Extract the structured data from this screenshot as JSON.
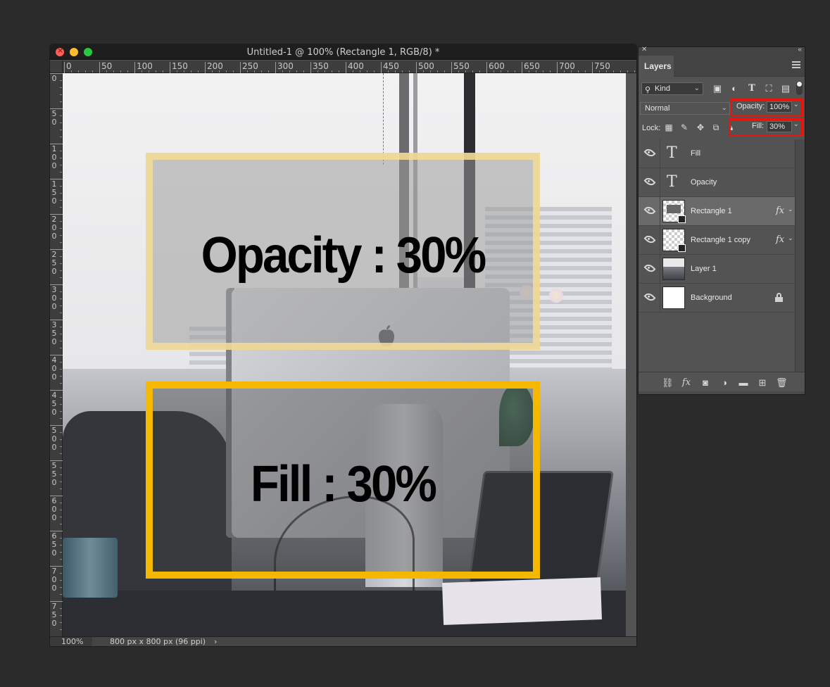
{
  "document": {
    "title": "Untitled-1 @ 100% (Rectangle 1, RGB/8) *",
    "ruler_h_labels": [
      "0",
      "50",
      "100",
      "150",
      "200",
      "250",
      "300",
      "350",
      "400",
      "450",
      "500",
      "550",
      "600",
      "650",
      "700",
      "750"
    ],
    "ruler_v_labels": [
      "0",
      "50",
      "100",
      "150",
      "200",
      "250",
      "300",
      "350",
      "400",
      "450",
      "500",
      "550",
      "600",
      "650",
      "700",
      "750"
    ],
    "canvas_text_opacity": "Opacity :  30%",
    "canvas_text_fill": "Fill :  30%",
    "status_zoom": "100%",
    "status_doc_info": "800 px x 800 px (96 ppi)",
    "status_arrow": "›"
  },
  "layers_panel": {
    "tab_label": "Layers",
    "filter_kind": "Kind",
    "blend_mode": "Normal",
    "opacity_label": "Opacity:",
    "opacity_value": "100%",
    "lock_label": "Lock:",
    "fill_label": "Fill:",
    "fill_value": "30%",
    "highlight_color": "#e8140e",
    "layers": [
      {
        "name": "Fill",
        "kind": "text",
        "fx": false,
        "locked": false,
        "selected": false
      },
      {
        "name": "Opacity",
        "kind": "text",
        "fx": false,
        "locked": false,
        "selected": false
      },
      {
        "name": "Rectangle 1",
        "kind": "shape",
        "fx": true,
        "locked": false,
        "selected": true
      },
      {
        "name": "Rectangle 1 copy",
        "kind": "shape",
        "fx": true,
        "locked": false,
        "selected": false
      },
      {
        "name": "Layer 1",
        "kind": "photo",
        "fx": false,
        "locked": false,
        "selected": false
      },
      {
        "name": "Background",
        "kind": "background",
        "fx": false,
        "locked": true,
        "selected": false
      }
    ],
    "fx_symbol": "fx",
    "text_layer_glyph": "T"
  },
  "colors": {
    "rect_opacity_border": "#f6dd96",
    "rect_fill_border": "#f5b800",
    "selected_layer": "#6a6a6a"
  }
}
